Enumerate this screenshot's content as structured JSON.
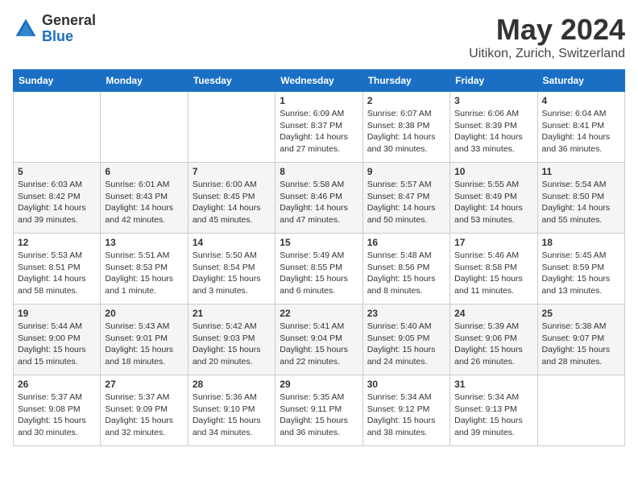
{
  "header": {
    "logo": {
      "general": "General",
      "blue": "Blue"
    },
    "title": "May 2024",
    "location": "Uitikon, Zurich, Switzerland"
  },
  "days_of_week": [
    "Sunday",
    "Monday",
    "Tuesday",
    "Wednesday",
    "Thursday",
    "Friday",
    "Saturday"
  ],
  "weeks": [
    [
      {
        "day": "",
        "info": ""
      },
      {
        "day": "",
        "info": ""
      },
      {
        "day": "",
        "info": ""
      },
      {
        "day": "1",
        "info": "Sunrise: 6:09 AM\nSunset: 8:37 PM\nDaylight: 14 hours\nand 27 minutes."
      },
      {
        "day": "2",
        "info": "Sunrise: 6:07 AM\nSunset: 8:38 PM\nDaylight: 14 hours\nand 30 minutes."
      },
      {
        "day": "3",
        "info": "Sunrise: 6:06 AM\nSunset: 8:39 PM\nDaylight: 14 hours\nand 33 minutes."
      },
      {
        "day": "4",
        "info": "Sunrise: 6:04 AM\nSunset: 8:41 PM\nDaylight: 14 hours\nand 36 minutes."
      }
    ],
    [
      {
        "day": "5",
        "info": "Sunrise: 6:03 AM\nSunset: 8:42 PM\nDaylight: 14 hours\nand 39 minutes."
      },
      {
        "day": "6",
        "info": "Sunrise: 6:01 AM\nSunset: 8:43 PM\nDaylight: 14 hours\nand 42 minutes."
      },
      {
        "day": "7",
        "info": "Sunrise: 6:00 AM\nSunset: 8:45 PM\nDaylight: 14 hours\nand 45 minutes."
      },
      {
        "day": "8",
        "info": "Sunrise: 5:58 AM\nSunset: 8:46 PM\nDaylight: 14 hours\nand 47 minutes."
      },
      {
        "day": "9",
        "info": "Sunrise: 5:57 AM\nSunset: 8:47 PM\nDaylight: 14 hours\nand 50 minutes."
      },
      {
        "day": "10",
        "info": "Sunrise: 5:55 AM\nSunset: 8:49 PM\nDaylight: 14 hours\nand 53 minutes."
      },
      {
        "day": "11",
        "info": "Sunrise: 5:54 AM\nSunset: 8:50 PM\nDaylight: 14 hours\nand 55 minutes."
      }
    ],
    [
      {
        "day": "12",
        "info": "Sunrise: 5:53 AM\nSunset: 8:51 PM\nDaylight: 14 hours\nand 58 minutes."
      },
      {
        "day": "13",
        "info": "Sunrise: 5:51 AM\nSunset: 8:53 PM\nDaylight: 15 hours\nand 1 minute."
      },
      {
        "day": "14",
        "info": "Sunrise: 5:50 AM\nSunset: 8:54 PM\nDaylight: 15 hours\nand 3 minutes."
      },
      {
        "day": "15",
        "info": "Sunrise: 5:49 AM\nSunset: 8:55 PM\nDaylight: 15 hours\nand 6 minutes."
      },
      {
        "day": "16",
        "info": "Sunrise: 5:48 AM\nSunset: 8:56 PM\nDaylight: 15 hours\nand 8 minutes."
      },
      {
        "day": "17",
        "info": "Sunrise: 5:46 AM\nSunset: 8:58 PM\nDaylight: 15 hours\nand 11 minutes."
      },
      {
        "day": "18",
        "info": "Sunrise: 5:45 AM\nSunset: 8:59 PM\nDaylight: 15 hours\nand 13 minutes."
      }
    ],
    [
      {
        "day": "19",
        "info": "Sunrise: 5:44 AM\nSunset: 9:00 PM\nDaylight: 15 hours\nand 15 minutes."
      },
      {
        "day": "20",
        "info": "Sunrise: 5:43 AM\nSunset: 9:01 PM\nDaylight: 15 hours\nand 18 minutes."
      },
      {
        "day": "21",
        "info": "Sunrise: 5:42 AM\nSunset: 9:03 PM\nDaylight: 15 hours\nand 20 minutes."
      },
      {
        "day": "22",
        "info": "Sunrise: 5:41 AM\nSunset: 9:04 PM\nDaylight: 15 hours\nand 22 minutes."
      },
      {
        "day": "23",
        "info": "Sunrise: 5:40 AM\nSunset: 9:05 PM\nDaylight: 15 hours\nand 24 minutes."
      },
      {
        "day": "24",
        "info": "Sunrise: 5:39 AM\nSunset: 9:06 PM\nDaylight: 15 hours\nand 26 minutes."
      },
      {
        "day": "25",
        "info": "Sunrise: 5:38 AM\nSunset: 9:07 PM\nDaylight: 15 hours\nand 28 minutes."
      }
    ],
    [
      {
        "day": "26",
        "info": "Sunrise: 5:37 AM\nSunset: 9:08 PM\nDaylight: 15 hours\nand 30 minutes."
      },
      {
        "day": "27",
        "info": "Sunrise: 5:37 AM\nSunset: 9:09 PM\nDaylight: 15 hours\nand 32 minutes."
      },
      {
        "day": "28",
        "info": "Sunrise: 5:36 AM\nSunset: 9:10 PM\nDaylight: 15 hours\nand 34 minutes."
      },
      {
        "day": "29",
        "info": "Sunrise: 5:35 AM\nSunset: 9:11 PM\nDaylight: 15 hours\nand 36 minutes."
      },
      {
        "day": "30",
        "info": "Sunrise: 5:34 AM\nSunset: 9:12 PM\nDaylight: 15 hours\nand 38 minutes."
      },
      {
        "day": "31",
        "info": "Sunrise: 5:34 AM\nSunset: 9:13 PM\nDaylight: 15 hours\nand 39 minutes."
      },
      {
        "day": "",
        "info": ""
      }
    ]
  ]
}
